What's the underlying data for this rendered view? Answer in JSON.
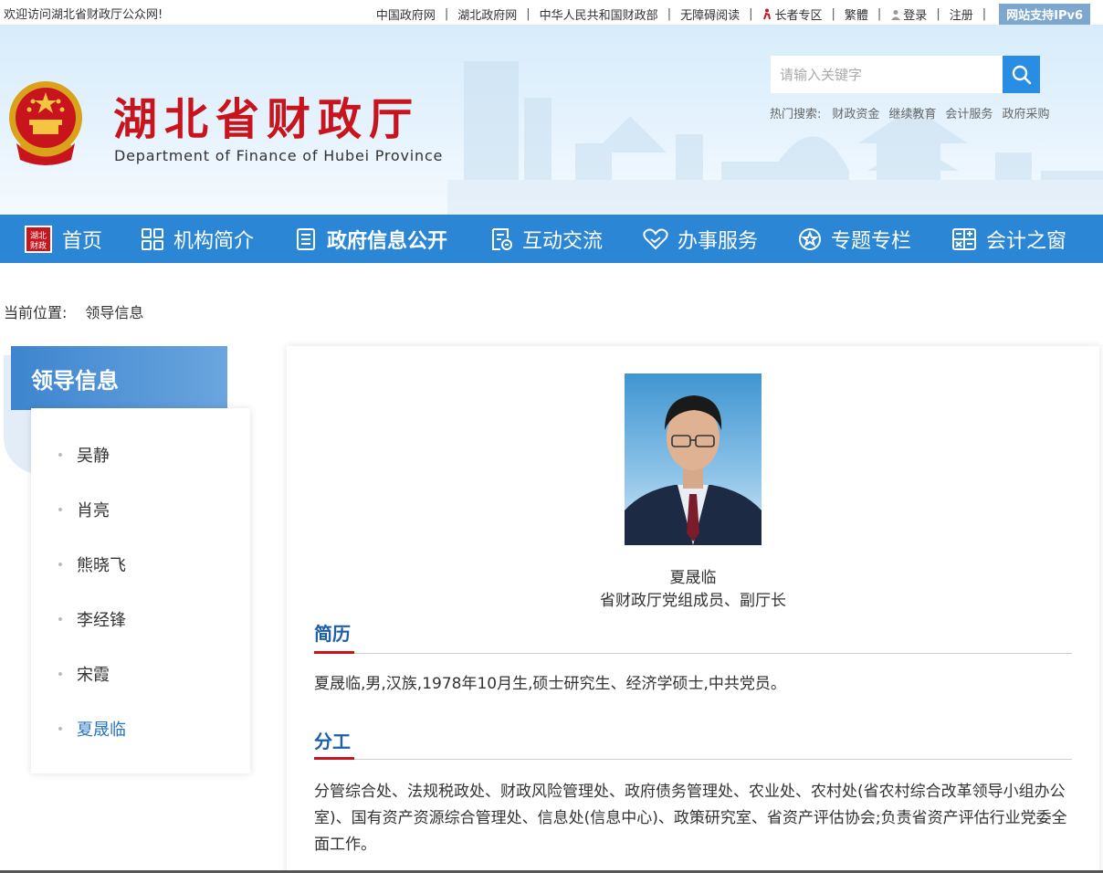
{
  "topbar": {
    "welcome": "欢迎访问湖北省财政厅公众网!",
    "links": [
      "中国政府网",
      "湖北政府网",
      "中华人民共和国财政部",
      "无障碍阅读"
    ],
    "elderly": "长者专区",
    "traditional": "繁體",
    "login": "登录",
    "register": "注册",
    "ipv6": "网站支持IPv6"
  },
  "header": {
    "title": "湖北省财政厅",
    "subtitle": "Department of Finance of Hubei Province",
    "search_placeholder": "请输入关键字",
    "hot_label": "热门搜索:",
    "hot_links": [
      "财政资金",
      "继续教育",
      "会计服务",
      "政府采购"
    ],
    "emblem_icon": "national-emblem-icon"
  },
  "nav": {
    "items": [
      {
        "label": "首页",
        "icon": "hubei-finance-seal-icon"
      },
      {
        "label": "机构简介",
        "icon": "grid-icon"
      },
      {
        "label": "政府信息公开",
        "icon": "document-icon"
      },
      {
        "label": "互动交流",
        "icon": "chat-form-icon"
      },
      {
        "label": "办事服务",
        "icon": "heart-hand-icon"
      },
      {
        "label": "专题专栏",
        "icon": "star-circle-icon"
      },
      {
        "label": "会计之窗",
        "icon": "calculator-icon"
      }
    ],
    "active_index": 2
  },
  "breadcrumb": {
    "label": "当前位置:",
    "current": "领导信息"
  },
  "sidebar": {
    "title": "领导信息",
    "items": [
      "吴静",
      "肖亮",
      "熊晓飞",
      "李经锋",
      "宋霞",
      "夏晟临"
    ],
    "active_index": 5
  },
  "profile": {
    "name": "夏晟临",
    "position": "省财政厅党组成员、副厅长",
    "resume_heading": "简历",
    "resume_text": "夏晟临,男,汉族,1978年10月生,硕士研究生、经济学硕士,中共党员。",
    "duty_heading": "分工",
    "duty_text": "分管综合处、法规税政处、财政风险管理处、政府债务管理处、农业处、农村处(省农村综合改革领导小组办公室)、国有资产资源综合管理处、信息处(信息中心)、政策研究室、省资产评估协会;负责省资产评估行业党委全面工作。"
  },
  "colors": {
    "nav_bg": "#2b87d6",
    "title_red": "#c8151d",
    "heading_blue": "#1d5ea8",
    "accent_red": "#c8151d"
  }
}
